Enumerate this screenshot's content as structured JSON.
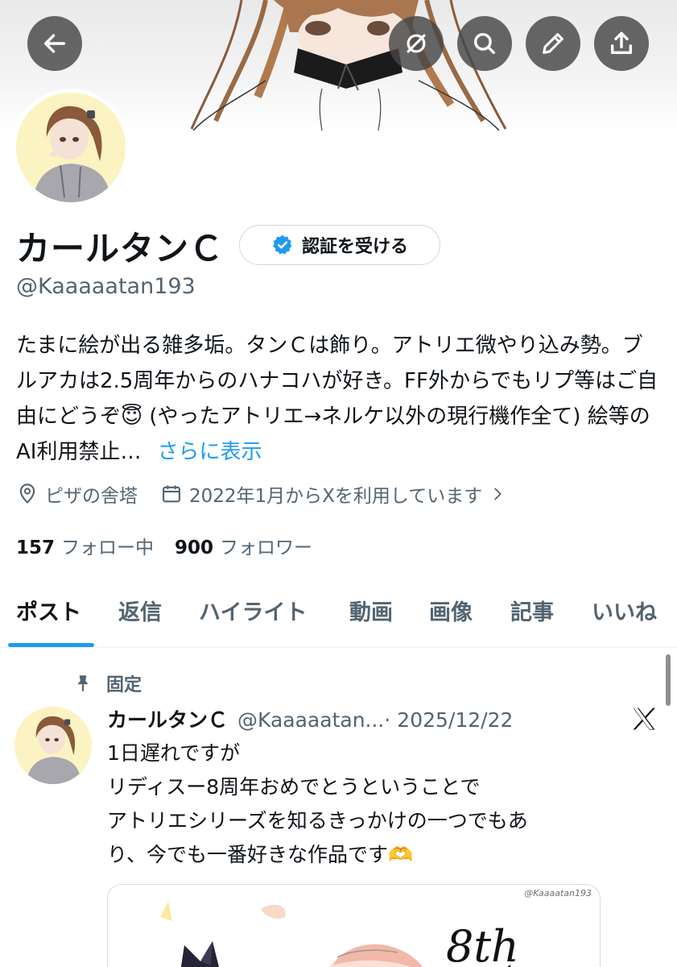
{
  "profile": {
    "name": "カールタンＣ",
    "verify_label": "認証を受ける",
    "handle": "@Kaaaaatan193",
    "bio_text": "たまに絵が出る雑多垢。タンＣは飾り。アトリエ微やり込み勢。ブルアカは2.5周年からのハナコハが好き。FF外からでもリプ等はご自由にどうぞ😇 (やったアトリエ→ネルケ以外の現行機作全て) 絵等のAI利用禁止…",
    "bio_more": "さらに表示",
    "location": "ピザの舎塔",
    "joined": "2022年1月からXを利用しています",
    "following_count": "157",
    "following_label": "フォロー中",
    "followers_count": "900",
    "followers_label": "フォロワー"
  },
  "header_buttons": {
    "back": "back-arrow-icon",
    "grok": "grok-icon",
    "search": "search-icon",
    "edit": "pencil-icon",
    "share": "share-icon"
  },
  "tabs": [
    {
      "label": "ポスト"
    },
    {
      "label": "返信"
    },
    {
      "label": "ハイライト"
    },
    {
      "label": "動画"
    },
    {
      "label": "画像"
    },
    {
      "label": "記事"
    },
    {
      "label": "いいね"
    }
  ],
  "pinned_post": {
    "pinned_label": "固定",
    "author_name": "カールタンＣ",
    "author_handle": "@Kaaaaatan...",
    "date": "· 2025/12/22",
    "lines": [
      "1日遅れですが",
      "リディスー8周年おめでとうということで",
      "アトリエシリーズを知るきっかけの一つでもあ",
      "り、今でも一番好きな作品です🫶"
    ],
    "image_credit": "@Kaaaatan193"
  },
  "colors": {
    "accent": "#1d9bf0",
    "text": "#0f1419",
    "secondary_text": "#536471"
  }
}
